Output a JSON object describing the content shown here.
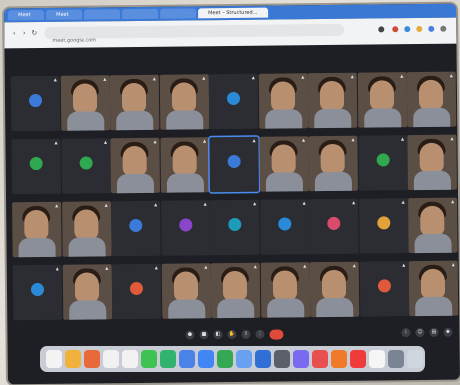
{
  "browser": {
    "tabs": [
      {
        "label": "Meet",
        "active": false
      },
      {
        "label": "Meet",
        "active": false
      },
      {
        "label": "",
        "active": false
      },
      {
        "label": "",
        "active": false
      },
      {
        "label": "",
        "active": false
      },
      {
        "label": "Meet – Structured...",
        "active": true
      }
    ],
    "address": "meet.google.com",
    "colors": {
      "tabbar": "#3a78d6",
      "toolbar": "#f2f3f5"
    }
  },
  "participants": [
    {
      "name": "",
      "type": "avatar",
      "color": "#3b7ad8"
    },
    {
      "name": "",
      "type": "video"
    },
    {
      "name": "",
      "type": "video"
    },
    {
      "name": "",
      "type": "video"
    },
    {
      "name": "",
      "type": "avatar",
      "color": "#2b8ad8"
    },
    {
      "name": "",
      "type": "video"
    },
    {
      "name": "",
      "type": "video"
    },
    {
      "name": "",
      "type": "video"
    },
    {
      "name": "",
      "type": "video"
    },
    {
      "name": "",
      "type": "avatar",
      "color": "#2fa84f"
    },
    {
      "name": "",
      "type": "avatar",
      "color": "#2fa84f"
    },
    {
      "name": "",
      "type": "video"
    },
    {
      "name": "",
      "type": "video"
    },
    {
      "name": "",
      "type": "avatar",
      "color": "#3b7ad8",
      "highlight": true
    },
    {
      "name": "",
      "type": "video"
    },
    {
      "name": "",
      "type": "video"
    },
    {
      "name": "",
      "type": "avatar",
      "color": "#2fa84f"
    },
    {
      "name": "",
      "type": "video"
    },
    {
      "name": "",
      "type": "video"
    },
    {
      "name": "",
      "type": "video"
    },
    {
      "name": "",
      "type": "avatar",
      "color": "#3b7ad8"
    },
    {
      "name": "",
      "type": "avatar",
      "color": "#8a46c9"
    },
    {
      "name": "",
      "type": "avatar",
      "color": "#1e9bb8"
    },
    {
      "name": "",
      "type": "avatar",
      "color": "#2b8ad8"
    },
    {
      "name": "",
      "type": "avatar",
      "color": "#d94b6b"
    },
    {
      "name": "",
      "type": "avatar",
      "color": "#e2a23a"
    },
    {
      "name": "",
      "type": "video"
    },
    {
      "name": "",
      "type": "avatar",
      "color": "#2b8ad8"
    },
    {
      "name": "",
      "type": "video"
    },
    {
      "name": "",
      "type": "avatar",
      "color": "#e0593a"
    },
    {
      "name": "",
      "type": "video"
    },
    {
      "name": "",
      "type": "video"
    },
    {
      "name": "",
      "type": "video"
    },
    {
      "name": "",
      "type": "video"
    },
    {
      "name": "",
      "type": "avatar",
      "color": "#e0593a"
    },
    {
      "name": "",
      "type": "video"
    }
  ],
  "dock_colors": [
    "#f3f3f3",
    "#f0b23a",
    "#e86a3a",
    "#f1f1f1",
    "#f2f2f2",
    "#3ec352",
    "#2fb36e",
    "#4b82e8",
    "#4285f4",
    "#34a853",
    "#6aa0f0",
    "#2f6fd6",
    "#5a5f6a",
    "#7a6af0",
    "#e85050",
    "#f07a2a",
    "#ef3b3b",
    "#f5f5f5",
    "#7a8493",
    "#cfd6e0"
  ]
}
